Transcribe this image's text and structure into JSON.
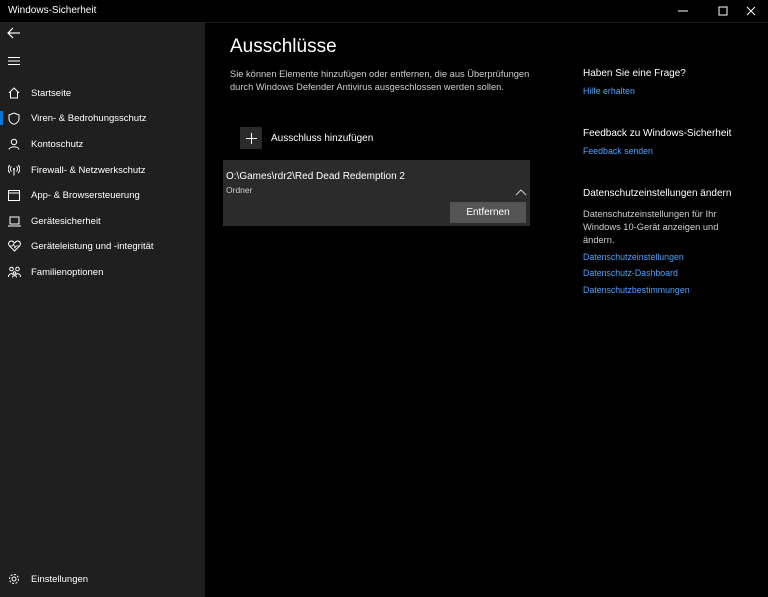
{
  "window": {
    "title": "Windows-Sicherheit",
    "controls": [
      "minimize-icon",
      "maximize-icon",
      "close-icon"
    ]
  },
  "sidebar": {
    "items": [
      {
        "label": "Startseite",
        "icon": "home-icon"
      },
      {
        "label": "Viren- & Bedrohungsschutz",
        "icon": "shield-icon",
        "selected": true
      },
      {
        "label": "Kontoschutz",
        "icon": "person-icon"
      },
      {
        "label": "Firewall- & Netzwerkschutz",
        "icon": "antenna-icon"
      },
      {
        "label": "App- & Browsersteuerung",
        "icon": "browser-window-icon"
      },
      {
        "label": "Gerätesicherheit",
        "icon": "laptop-icon"
      },
      {
        "label": "Geräteleistung und -integrität",
        "icon": "heart-icon"
      },
      {
        "label": "Familienoptionen",
        "icon": "family-icon"
      }
    ],
    "settings_label": "Einstellungen",
    "accent_color": "#0078d7"
  },
  "main": {
    "title": "Ausschlüsse",
    "description": "Sie können Elemente hinzufügen oder entfernen, die aus Überprüfungen durch Windows Defender Antivirus ausgeschlossen werden sollen.",
    "add_label": "Ausschluss hinzufügen",
    "exclusion": {
      "path": "O:\\Games\\rdr2\\Red Dead Redemption 2",
      "type": "Ordner",
      "remove_label": "Entfernen"
    }
  },
  "right": {
    "question_heading": "Haben Sie eine Frage?",
    "help_link": "Hilfe erhalten",
    "feedback_heading": "Feedback zu Windows-Sicherheit",
    "feedback_link": "Feedback senden",
    "privacy_heading": "Datenschutzeinstellungen ändern",
    "privacy_text": "Datenschutzeinstellungen für Ihr Windows 10-Gerät anzeigen und ändern.",
    "privacy_links": [
      "Datenschutzeinstellungen",
      "Datenschutz-Dashboard",
      "Datenschutzbestimmungen"
    ],
    "link_color": "#4da3ff"
  }
}
